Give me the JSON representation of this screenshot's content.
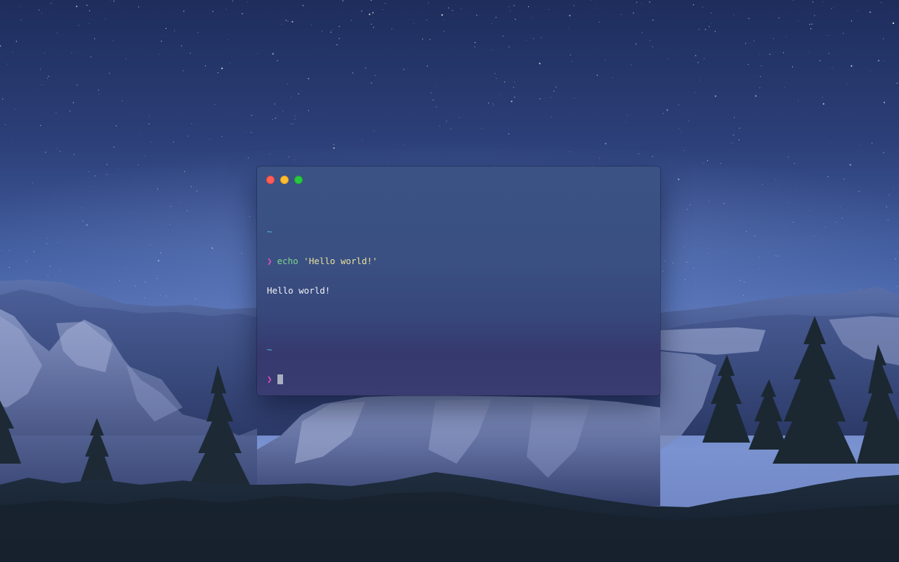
{
  "desktop": {
    "wallpaper": "night-sky-mountain-landscape"
  },
  "terminal": {
    "traffic_lights": {
      "close_color": "#ff5f57",
      "minimize_color": "#febc2e",
      "maximize_color": "#28c840"
    },
    "session": {
      "block1": {
        "directory": "~",
        "prompt_symbol": "❯",
        "command": "echo",
        "argument": "'Hello world!'",
        "output": "Hello world!"
      },
      "block2": {
        "directory": "~",
        "prompt_symbol": "❯",
        "command": ""
      }
    },
    "colors": {
      "directory": "#4fb8d8",
      "prompt": "#e351b8",
      "command": "#7fd88a",
      "string": "#e9e39a",
      "output": "#f3f3f6"
    }
  }
}
